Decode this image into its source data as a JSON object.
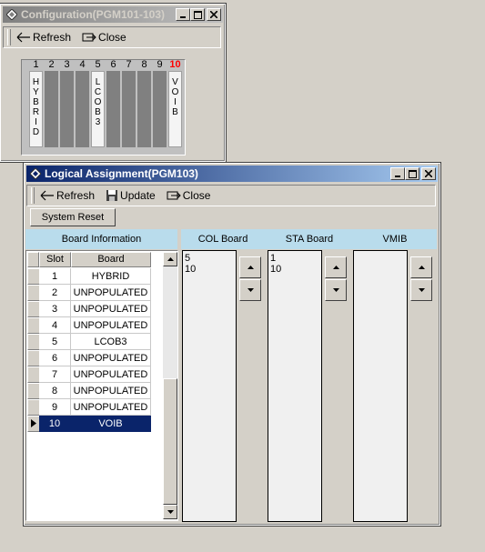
{
  "config_window": {
    "title": "Configuration(PGM101-103)",
    "toolbar": {
      "refresh": "Refresh",
      "close": "Close"
    },
    "slots": [
      {
        "num": "1",
        "label": "HYBRID",
        "highlight": false
      },
      {
        "num": "2",
        "label": "",
        "highlight": false
      },
      {
        "num": "3",
        "label": "",
        "highlight": false
      },
      {
        "num": "4",
        "label": "",
        "highlight": false
      },
      {
        "num": "5",
        "label": "LCOB3",
        "highlight": false
      },
      {
        "num": "6",
        "label": "",
        "highlight": false
      },
      {
        "num": "7",
        "label": "",
        "highlight": false
      },
      {
        "num": "8",
        "label": "",
        "highlight": false
      },
      {
        "num": "9",
        "label": "",
        "highlight": false
      },
      {
        "num": "10",
        "label": "VOIB",
        "highlight": true
      }
    ]
  },
  "logical_window": {
    "title": "Logical Assignment(PGM103)",
    "toolbar": {
      "refresh": "Refresh",
      "update": "Update",
      "close": "Close"
    },
    "system_reset": "System Reset",
    "board_info": {
      "header": "Board Information",
      "columns": [
        "Slot",
        "Board"
      ],
      "rows": [
        [
          "1",
          "HYBRID"
        ],
        [
          "2",
          "UNPOPULATED"
        ],
        [
          "3",
          "UNPOPULATED"
        ],
        [
          "4",
          "UNPOPULATED"
        ],
        [
          "5",
          "LCOB3"
        ],
        [
          "6",
          "UNPOPULATED"
        ],
        [
          "7",
          "UNPOPULATED"
        ],
        [
          "8",
          "UNPOPULATED"
        ],
        [
          "9",
          "UNPOPULATED"
        ],
        [
          "10",
          "VOIB"
        ]
      ],
      "selected_row": 9
    },
    "col_board": {
      "header": "COL Board",
      "items": [
        "5",
        "10"
      ]
    },
    "sta_board": {
      "header": "STA Board",
      "items": [
        "1",
        "10"
      ]
    },
    "vmib": {
      "header": "VMIB",
      "items": []
    }
  },
  "colors": {
    "active_title": "#0a246a",
    "highlight_number": "#ff0000",
    "header_bg": "#b9dcec"
  }
}
